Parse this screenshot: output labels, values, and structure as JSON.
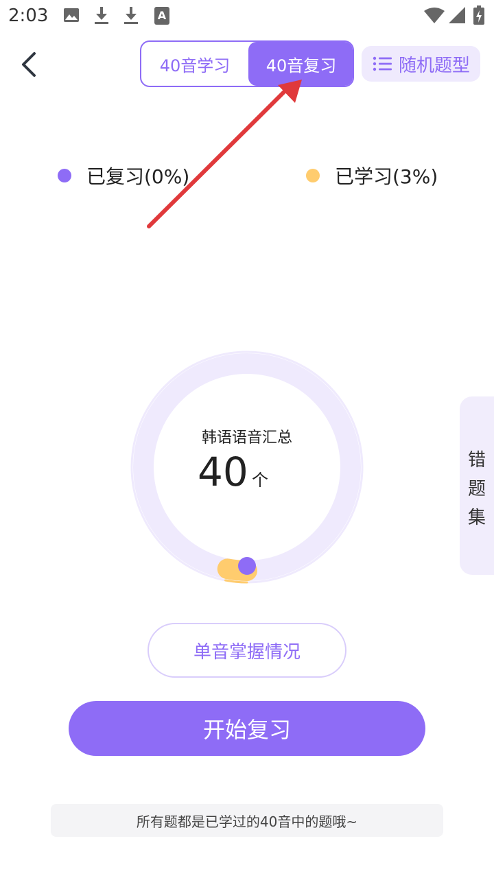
{
  "status_bar": {
    "time": "2:03",
    "left_icons": [
      "image-icon",
      "download-icon",
      "download-icon",
      "font-a-icon"
    ],
    "right_icons": [
      "wifi-icon",
      "signal-icon",
      "battery-charging-icon"
    ]
  },
  "header": {
    "back_icon": "chevron-left-icon",
    "tabs": [
      {
        "label": "40音学习",
        "active": false
      },
      {
        "label": "40音复习",
        "active": true
      }
    ],
    "random_button": {
      "icon": "list-icon",
      "label": "随机题型"
    }
  },
  "legend": [
    {
      "label": "已复习(0%)",
      "color": "#8e6cf6",
      "percent": 0
    },
    {
      "label": "已学习(3%)",
      "color": "#ffcc6e",
      "percent": 3
    }
  ],
  "summary": {
    "title": "韩语语音汇总",
    "count": "40",
    "unit": "个"
  },
  "side_tab": {
    "chars": [
      "错",
      "题",
      "集"
    ]
  },
  "mastery_button": {
    "label": "单音掌握情况"
  },
  "start_button": {
    "label": "开始复习"
  },
  "tip": {
    "text": "所有题都是已学过的40音中的题哦~"
  },
  "colors": {
    "accent": "#8e6cf6",
    "learned": "#ffcc6e",
    "ring_track": "#efeafd",
    "annotation_arrow": "#e0393b"
  }
}
